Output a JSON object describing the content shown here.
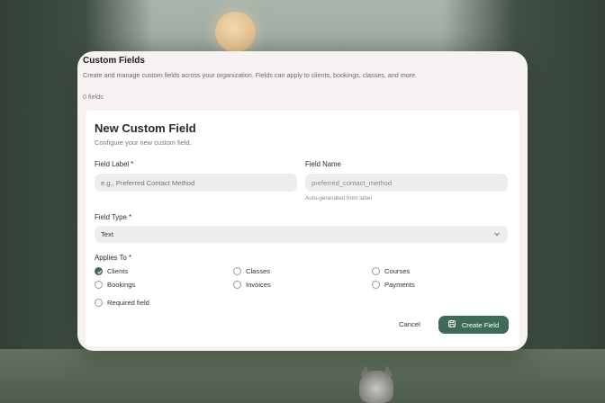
{
  "panel": {
    "title": "Custom Fields",
    "subtitle": "Create and manage custom fields across your organization. Fields can apply to clients, bookings, classes, and more.",
    "count": "0 fields"
  },
  "form": {
    "title": "New Custom Field",
    "subtitle": "Configure your new custom field.",
    "field_label": {
      "label": "Field Label *",
      "placeholder": "e.g., Preferred Contact Method",
      "value": ""
    },
    "field_name": {
      "label": "Field Name",
      "value": "preferred_contact_method",
      "hint": "Auto-generated from label"
    },
    "field_type": {
      "label": "Field Type *",
      "selected": "Text"
    },
    "applies_to": {
      "label": "Applies To *",
      "options": [
        {
          "label": "Clients",
          "checked": true
        },
        {
          "label": "Classes",
          "checked": false
        },
        {
          "label": "Courses",
          "checked": false
        },
        {
          "label": "Bookings",
          "checked": false
        },
        {
          "label": "Invoices",
          "checked": false
        },
        {
          "label": "Payments",
          "checked": false
        }
      ]
    },
    "required": {
      "label": "Required field",
      "checked": false
    },
    "cancel_label": "Cancel",
    "create_label": "Create Field"
  },
  "colors": {
    "accent": "#3e6a58",
    "panel_bg": "#f5f2f1",
    "input_bg": "#efedec"
  },
  "icons": {
    "select_chevron": "chevron-down-icon",
    "create_button": "save-icon",
    "checked_box": "check-icon"
  }
}
